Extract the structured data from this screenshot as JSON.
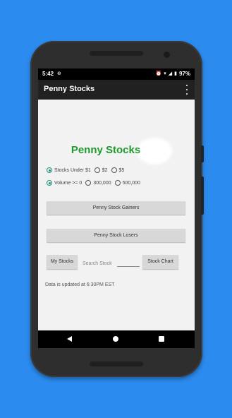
{
  "status_bar": {
    "time": "5:42",
    "battery": "97%"
  },
  "app_bar": {
    "title": "Penny Stocks"
  },
  "main": {
    "headline": "Penny Stocks",
    "price_options": {
      "options": [
        "Stocks Under $1",
        "$2",
        "$5"
      ],
      "selected": "Stocks Under $1"
    },
    "volume_options": {
      "options": [
        "Volume >= 0",
        "300,000",
        "500,000"
      ],
      "selected": "Volume >= 0"
    },
    "gainers_button": "Penny Stock Gainers",
    "losers_button": "Penny Stock Losers",
    "my_stocks_button": "My Stocks",
    "search_label": "Search Stock",
    "search_value": "",
    "stock_chart_button": "Stock Chart",
    "update_note": "Data is updated at 6:30PM EST"
  },
  "colors": {
    "background": "#2b8bef",
    "headline": "#1f9a2e",
    "radio_accent": "#17907a",
    "app_bar": "#212121"
  }
}
